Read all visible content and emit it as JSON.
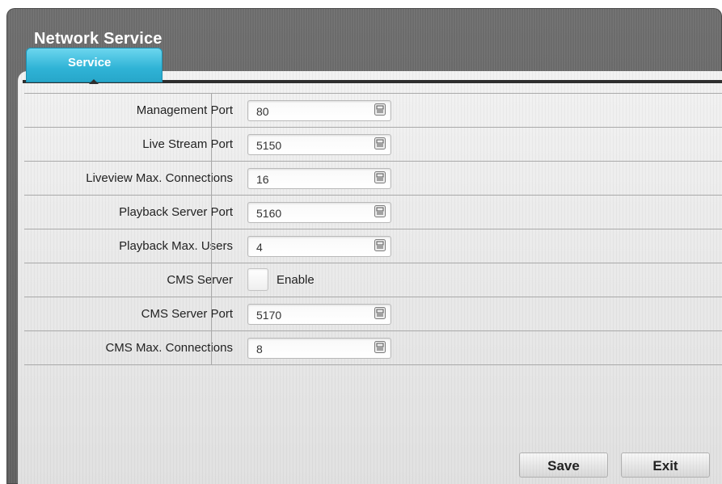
{
  "window": {
    "title": "Network Service"
  },
  "tabs": [
    {
      "label": "Service",
      "active": true
    }
  ],
  "settings": {
    "rows": [
      {
        "label": "Management Port",
        "value": "80"
      },
      {
        "label": "Live Stream Port",
        "value": "5150"
      },
      {
        "label": "Liveview Max. Connections",
        "value": "16"
      },
      {
        "label": "Playback Server Port",
        "value": "5160"
      },
      {
        "label": "Playback Max. Users",
        "value": "4"
      }
    ],
    "cms_server": {
      "label": "CMS Server",
      "checkbox_label": "Enable",
      "checked": false
    },
    "cms_rows": [
      {
        "label": "CMS Server Port",
        "value": "5170"
      },
      {
        "label": "CMS Max. Connections",
        "value": "8"
      }
    ]
  },
  "buttons": {
    "save": "Save",
    "exit": "Exit"
  },
  "colors": {
    "tab_accent": "#2fb3d6",
    "window_frame": "#666666"
  },
  "icons": {
    "field_action": "keyboard-icon"
  }
}
